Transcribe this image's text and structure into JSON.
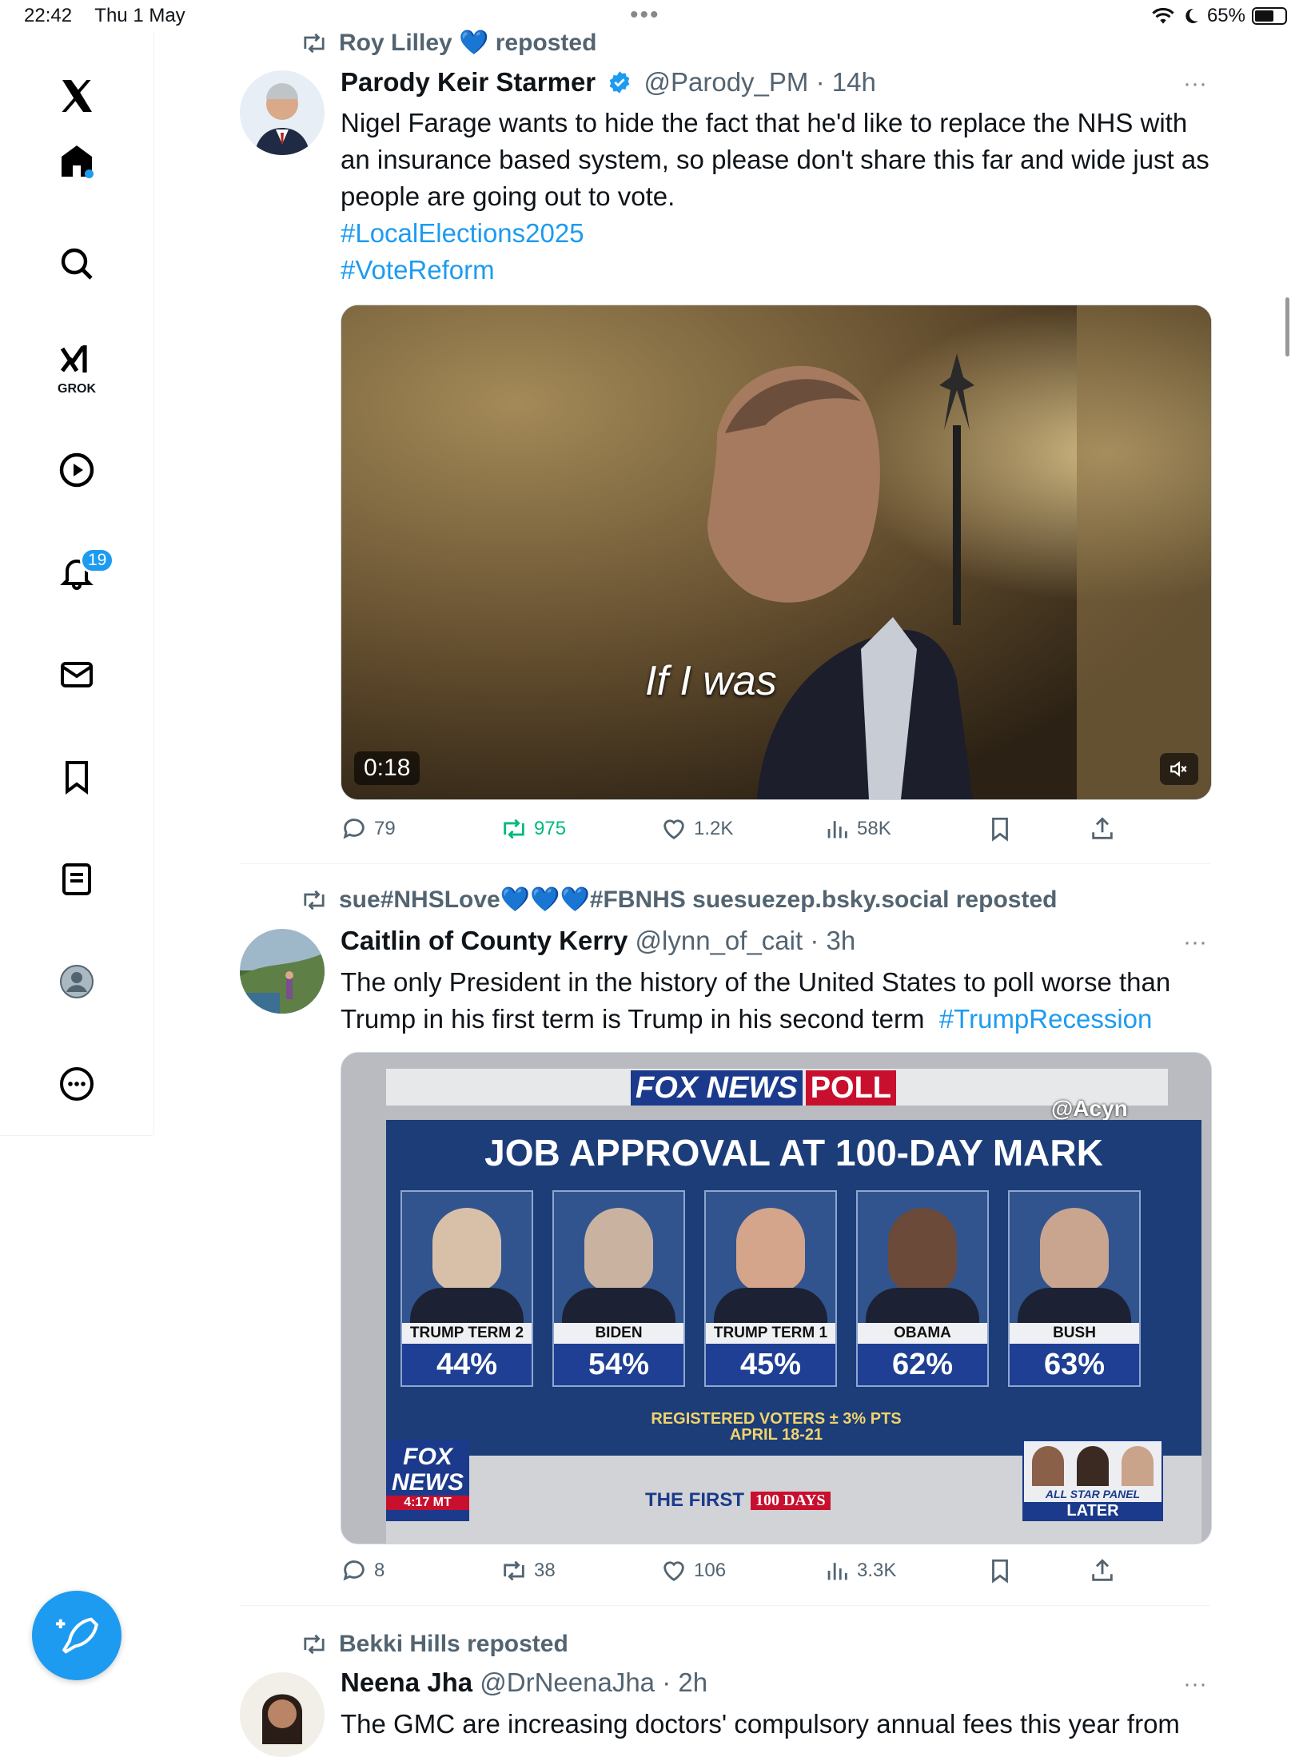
{
  "status": {
    "time": "22:42",
    "date": "Thu 1 May",
    "battery": "65%",
    "battery_level": 0.65
  },
  "sidebar": {
    "grok_label": "GROK",
    "notifications_badge": "19"
  },
  "posts": [
    {
      "repost_by": "Roy Lilley 💙 reposted",
      "name": "Parody Keir Starmer",
      "handle": "@Parody_PM",
      "time": "14h",
      "text": "Nigel Farage wants to hide the fact that he'd like to replace the NHS with an insurance based system, so please don't share this far and wide just as people are going out to vote.",
      "tags": [
        "#LocalElections2025",
        "#VoteReform"
      ],
      "video_caption": "If I was",
      "video_duration": "0:18",
      "replies": "79",
      "reposts": "975",
      "likes": "1.2K",
      "views": "58K"
    },
    {
      "repost_by": "sue#NHSLove💙💙💙#FBNHS suesuezep.bsky.social reposted",
      "name": "Caitlin of County Kerry",
      "handle": "@lynn_of_cait",
      "time": "3h",
      "text": "The only President in the history of the United States to poll worse than Trump in his first term is Trump in his second term",
      "tag": "#TrumpRecession",
      "replies": "8",
      "reposts": "38",
      "likes": "106",
      "views": "3.3K",
      "graphic": {
        "brand": "FOX NEWS",
        "poll": "POLL",
        "source_tag": "@Acyn",
        "title": "JOB APPROVAL AT 100-DAY MARK",
        "candidates": [
          {
            "label": "TRUMP TERM 2",
            "value": "44%"
          },
          {
            "label": "BIDEN",
            "value": "54%"
          },
          {
            "label": "TRUMP TERM 1",
            "value": "45%"
          },
          {
            "label": "OBAMA",
            "value": "62%"
          },
          {
            "label": "BUSH",
            "value": "63%"
          }
        ],
        "footnote_1": "REGISTERED VOTERS ± 3% PTS",
        "footnote_2": "APRIL 18-21",
        "logo_top": "FOX",
        "logo_bottom": "NEWS",
        "clock": "4:17 MT",
        "ticker_a": "THE FIRST",
        "ticker_b": "100 DAYS",
        "panel_1": "ALL STAR PANEL",
        "panel_2": "LATER"
      }
    },
    {
      "repost_by": "Bekki Hills reposted",
      "name": "Neena Jha",
      "handle": "@DrNeenaJha",
      "time": "2h",
      "text": "The GMC are increasing doctors' compulsory annual fees this year from"
    }
  ]
}
